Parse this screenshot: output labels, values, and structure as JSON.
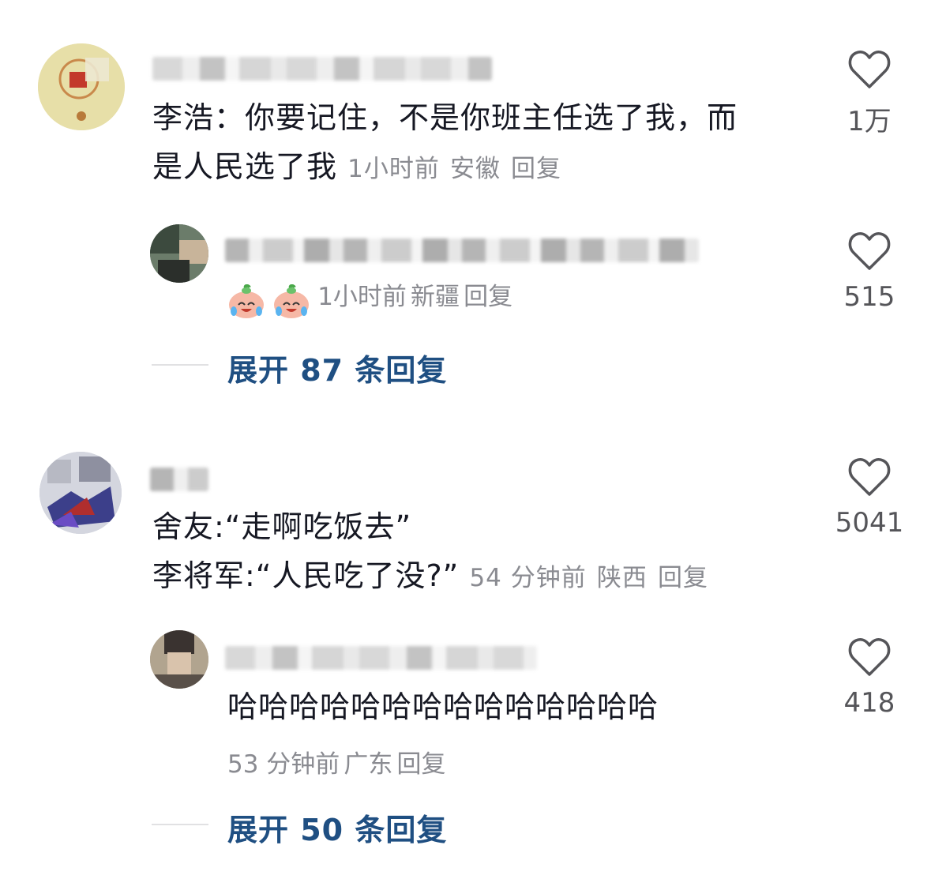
{
  "comments": [
    {
      "text_lines": [
        "李浩：你要记住，不是你班主任选了我，而",
        "是人民选了我"
      ],
      "time": "1小时前",
      "location": "安徽",
      "reply_label": "回复",
      "likes": "1万",
      "reply": {
        "text": "",
        "emoji_count": 2,
        "time": "1小时前",
        "location": "新疆",
        "reply_label": "回复",
        "likes": "515"
      },
      "expand_label": "展开 87 条回复"
    },
    {
      "text_lines": [
        "舍友:“走啊吃饭去”",
        "李将军:“人民吃了没?”"
      ],
      "time": "54 分钟前",
      "location": "陕西",
      "reply_label": "回复",
      "likes": "5041",
      "reply": {
        "text": "哈哈哈哈哈哈哈哈哈哈哈哈哈哈",
        "time": "53 分钟前",
        "location": "广东",
        "reply_label": "回复",
        "likes": "418"
      },
      "expand_label": "展开 50 条回复"
    }
  ],
  "colors": {
    "text": "#161823",
    "meta": "#8a8b91",
    "expand": "#1f4f82",
    "like": "#555559"
  },
  "icons": {
    "like": "heart-outline-icon",
    "emoji": "crying-laughing-peach-emoji"
  }
}
